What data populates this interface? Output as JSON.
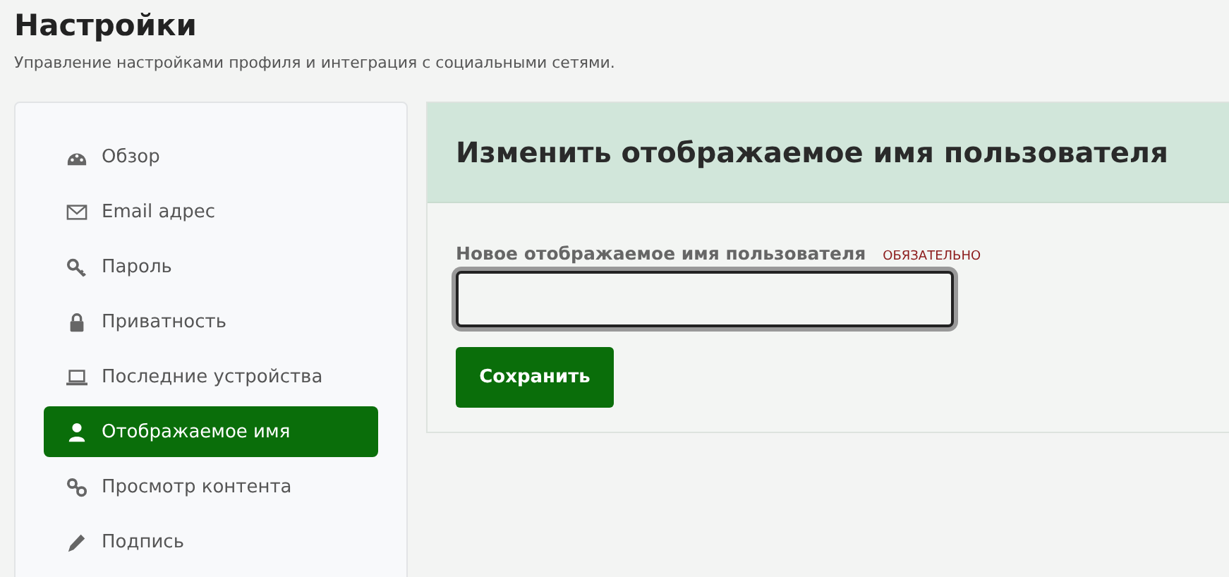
{
  "page": {
    "title": "Настройки",
    "subtitle": "Управление настройками профиля и интеграция с социальными сетями."
  },
  "sidebar": {
    "items": [
      {
        "label": "Обзор",
        "selected": false
      },
      {
        "label": "Email адрес",
        "selected": false
      },
      {
        "label": "Пароль",
        "selected": false
      },
      {
        "label": "Приватность",
        "selected": false
      },
      {
        "label": "Последние устройства",
        "selected": false
      },
      {
        "label": "Отображаемое имя",
        "selected": true
      },
      {
        "label": "Просмотр контента",
        "selected": false
      },
      {
        "label": "Подпись",
        "selected": false
      }
    ]
  },
  "panel": {
    "title": "Изменить отображаемое имя пользователя",
    "field": {
      "label": "Новое отображаемое имя пользователя",
      "required": "ОБЯЗАТЕЛЬНО",
      "focused": true
    },
    "button": "Сохранить"
  }
}
